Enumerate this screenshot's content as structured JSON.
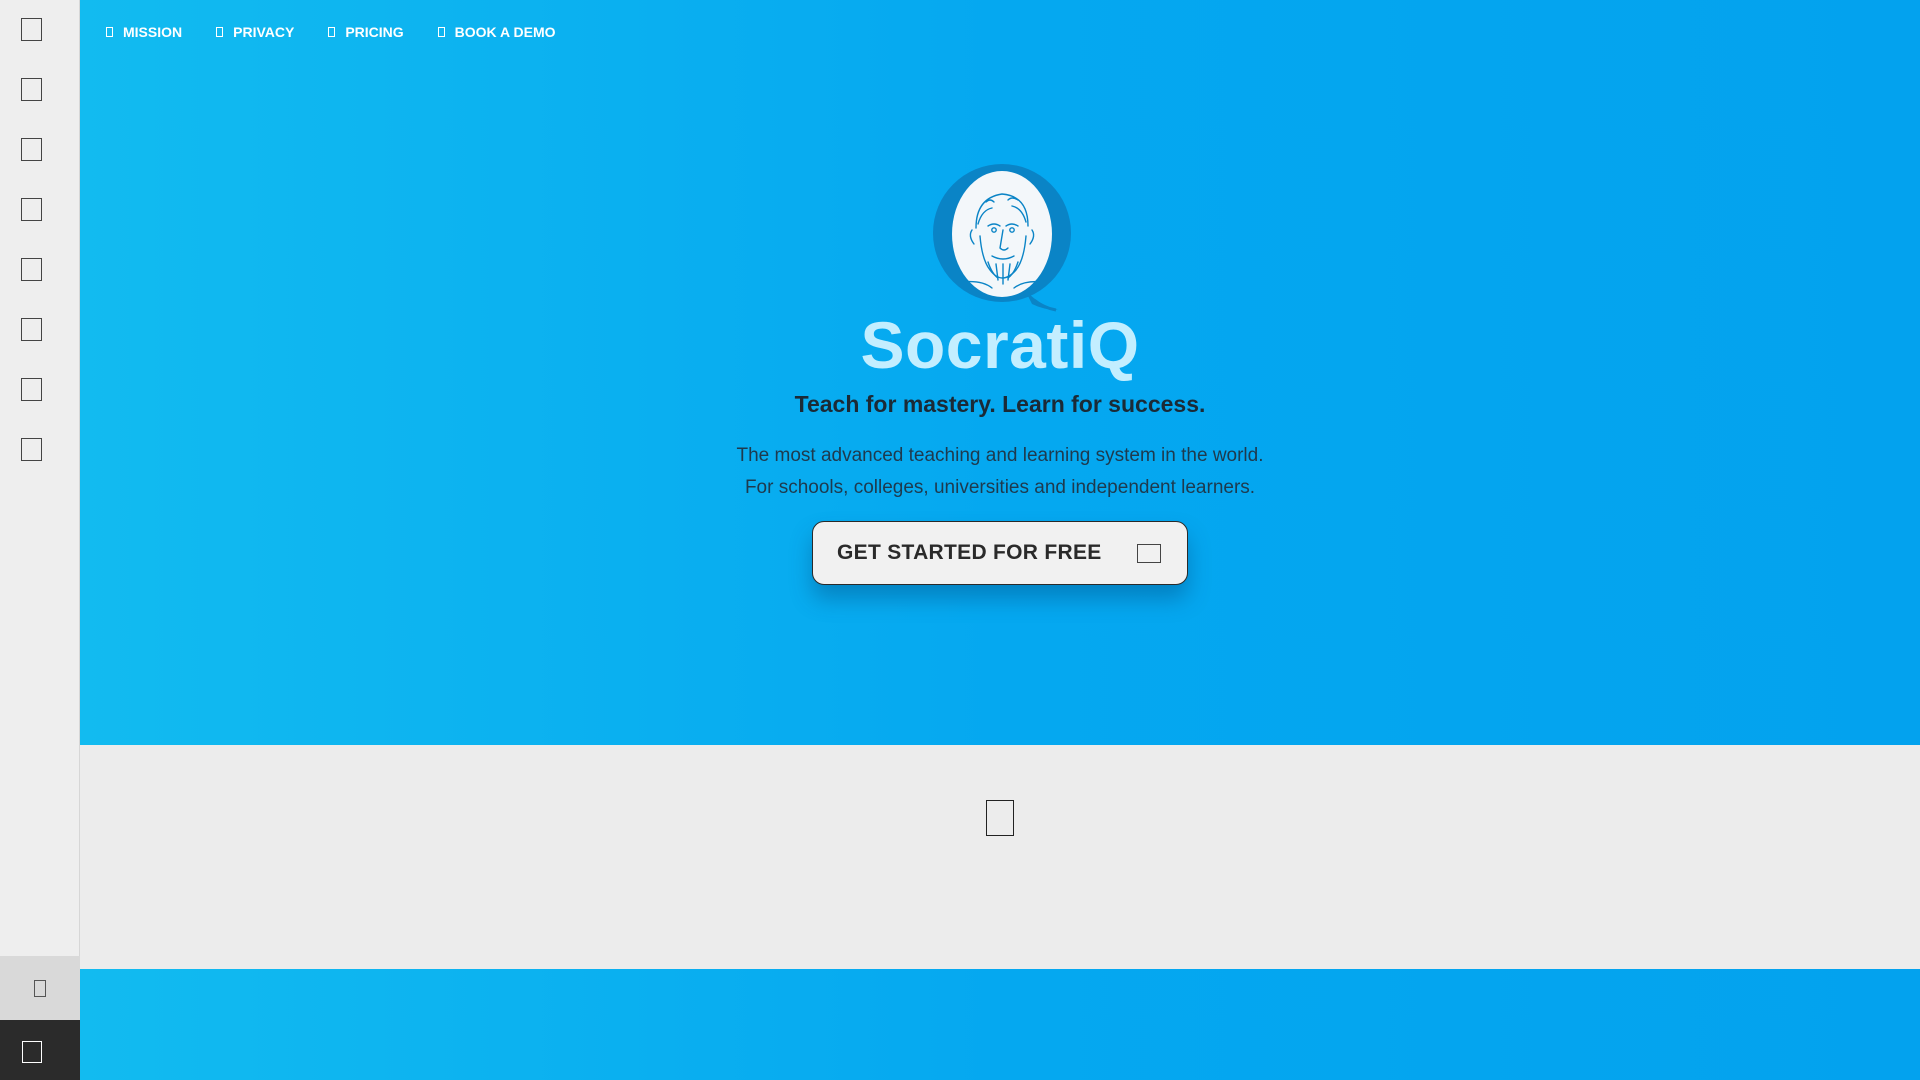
{
  "sidebar": {
    "items": [
      {
        "icon": "square-icon"
      },
      {
        "icon": "square-icon"
      },
      {
        "icon": "square-icon"
      },
      {
        "icon": "square-icon"
      },
      {
        "icon": "square-icon"
      },
      {
        "icon": "square-icon"
      },
      {
        "icon": "square-icon"
      },
      {
        "icon": "square-icon"
      }
    ]
  },
  "nav": {
    "items": [
      {
        "label": "MISSION"
      },
      {
        "label": "PRIVACY"
      },
      {
        "label": "PRICING"
      },
      {
        "label": "BOOK A DEMO"
      }
    ]
  },
  "hero": {
    "brand": "SocratiQ",
    "tagline": "Teach for mastery. Learn for success.",
    "description_line1": "The most advanced teaching and learning system in the world.",
    "description_line2": "For schools, colleges, universities and independent learners.",
    "cta_label": "GET STARTED FOR FREE"
  },
  "colors": {
    "hero_gradient_start": "#12bbf0",
    "hero_gradient_end": "#03a2ee",
    "brand_text": "#c3eeff",
    "logo_blue": "#0a84c6",
    "band_bg": "#ececec"
  }
}
